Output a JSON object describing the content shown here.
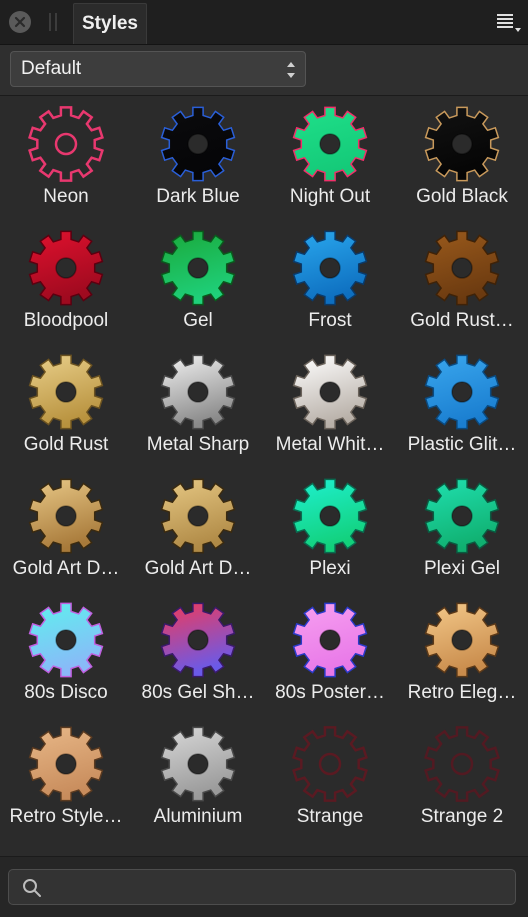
{
  "panel": {
    "tab_label": "Styles",
    "close_icon": "close-icon",
    "menu_icon": "panel-menu-icon"
  },
  "category": {
    "selected": "Default"
  },
  "search": {
    "placeholder": "",
    "value": "",
    "icon": "search-icon"
  },
  "styles": [
    {
      "label": "Neon",
      "colors": [
        "#2a2a2a",
        "#2a2a2a"
      ],
      "outline": "#e8386f"
    },
    {
      "label": "Dark Blue",
      "colors": [
        "#0b0b0d",
        "#050507"
      ],
      "outline": "#2a5fd8"
    },
    {
      "label": "Night Out",
      "colors": [
        "#1fe08a",
        "#14c978"
      ],
      "outline": "#f0306a"
    },
    {
      "label": "Gold Black",
      "colors": [
        "#121212",
        "#050505"
      ],
      "outline": "#c99a5c"
    },
    {
      "label": "Bloodpool",
      "colors": [
        "#e0112e",
        "#9e0a1f"
      ],
      "outline": "#5a0010"
    },
    {
      "label": "Gel",
      "colors": [
        "#1aa83a",
        "#1fd07a"
      ],
      "outline": "#0a5a1c"
    },
    {
      "label": "Frost",
      "colors": [
        "#2aa8ee",
        "#0e6fc0"
      ],
      "outline": "#0a3a6a"
    },
    {
      "label": "Gold Rust…",
      "colors": [
        "#9a5a1c",
        "#6b3a10"
      ],
      "outline": "#3e2208"
    },
    {
      "label": "Gold Rust",
      "colors": [
        "#e9cf8a",
        "#b8923e"
      ],
      "outline": "#6b5220"
    },
    {
      "label": "Metal Sharp",
      "colors": [
        "#f2f2f2",
        "#8a8a8a"
      ],
      "outline": "#4a4a4a"
    },
    {
      "label": "Metal Whit…",
      "colors": [
        "#ffffff",
        "#b8b0a8"
      ],
      "outline": "#6a625a"
    },
    {
      "label": "Plastic Glit…",
      "colors": [
        "#3aa7ee",
        "#1a7ed0"
      ],
      "outline": "#0a4a80"
    },
    {
      "label": "Gold Art D…",
      "colors": [
        "#e8c887",
        "#a87a3a"
      ],
      "outline": "#3a2a10"
    },
    {
      "label": "Gold Art D…",
      "colors": [
        "#e6c884",
        "#b08a46"
      ],
      "outline": "#3a2a10"
    },
    {
      "label": "Plexi",
      "colors": [
        "#1ff0d0",
        "#12d07a"
      ],
      "outline": "#0a6a50"
    },
    {
      "label": "Plexi Gel",
      "colors": [
        "#20e0b0",
        "#10b070"
      ],
      "outline": "#0a5a40"
    },
    {
      "label": "80s Disco",
      "colors": [
        "#5ef0ee",
        "#8ab8f8"
      ],
      "outline": "#c060e0"
    },
    {
      "label": "80s Gel Sh…",
      "colors": [
        "#f03a5a",
        "#6a5ae8"
      ],
      "outline": "#3a1a6a"
    },
    {
      "label": "80s Poster…",
      "colors": [
        "#f7a0f0",
        "#e878e8"
      ],
      "outline": "#2a3ac8"
    },
    {
      "label": "Retro Eleg…",
      "colors": [
        "#f4c98a",
        "#c98c4c"
      ],
      "outline": "#5a3818"
    },
    {
      "label": "Retro Style…",
      "colors": [
        "#e8b888",
        "#c88c5c"
      ],
      "outline": "#5a3a20"
    },
    {
      "label": "Aluminium",
      "colors": [
        "#d8d8d8",
        "#9a9a9a"
      ],
      "outline": "#4a4a4a"
    },
    {
      "label": "Strange",
      "colors": [
        "#2b2b2b",
        "#2b2b2b"
      ],
      "outline": "#5a1a22"
    },
    {
      "label": "Strange 2",
      "colors": [
        "#2b2b2b",
        "#2b2b2b"
      ],
      "outline": "#521a22"
    }
  ]
}
